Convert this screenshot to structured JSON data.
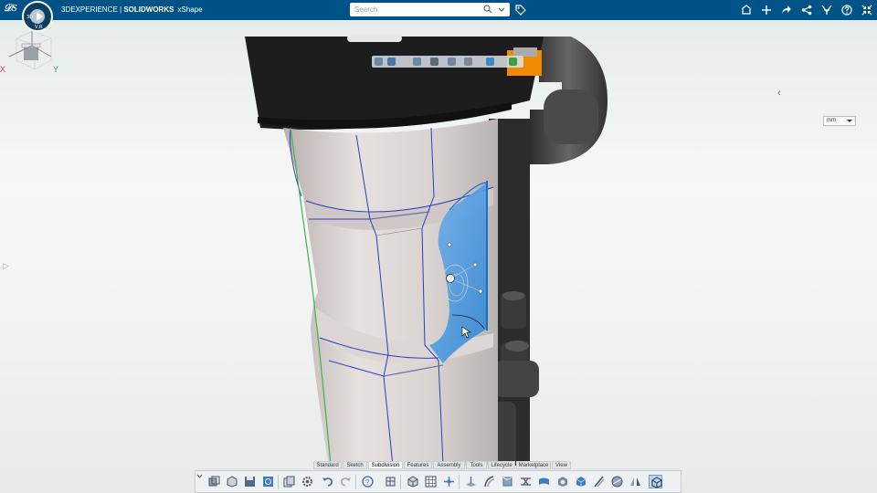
{
  "header": {
    "brand_prefix": "3DEXPERIENCE",
    "brand_separator": " | ",
    "brand_product": "SOLIDWORKS",
    "app_name": "xShape",
    "compass_labels": {
      "top": "",
      "left": "3D",
      "right": "",
      "bottom": "V,R"
    }
  },
  "search": {
    "placeholder": "Search",
    "value": ""
  },
  "top_icons": [
    "tag-icon",
    "share-icon",
    "add-icon",
    "forward-icon",
    "network-icon",
    "tools-icon",
    "help-icon",
    "collapse-icon"
  ],
  "viewcube": {
    "z": "Z",
    "x": "X",
    "y": "Y"
  },
  "units": {
    "selected": "mm"
  },
  "tabs": [
    {
      "label": "Standard",
      "active": false
    },
    {
      "label": "Sketch",
      "active": false
    },
    {
      "label": "Subdivision",
      "active": true
    },
    {
      "label": "Features",
      "active": false
    },
    {
      "label": "Assembly",
      "active": false
    },
    {
      "label": "Tools",
      "active": false
    },
    {
      "label": "Lifecycle",
      "active": false
    },
    {
      "label": "Marketplace",
      "active": false
    },
    {
      "label": "View",
      "active": false
    }
  ],
  "colors": {
    "topbar": "#005386",
    "selection_blue": "#3a8fd8",
    "edge_blue": "#2b3fbf",
    "edge_green": "#3fb24a",
    "accent_orange": "#f08a00"
  }
}
